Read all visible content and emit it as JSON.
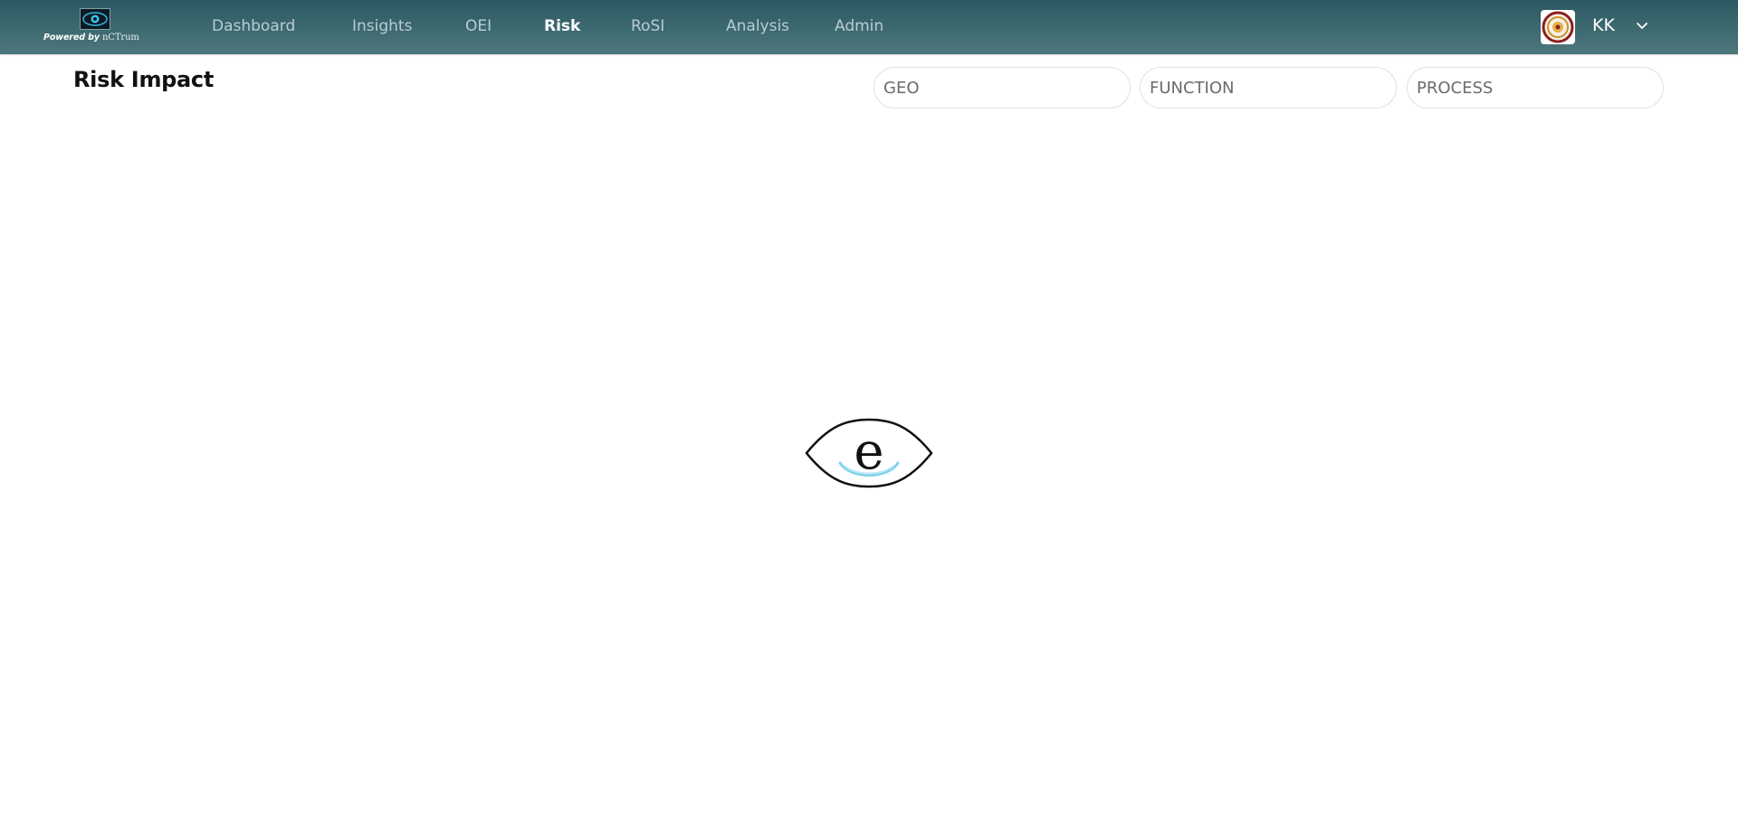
{
  "brand": {
    "powered_by": "Powered by",
    "company": "nCTrum"
  },
  "nav": {
    "items": [
      {
        "label": "Dashboard"
      },
      {
        "label": "Insights"
      },
      {
        "label": "OEI"
      },
      {
        "label": "Risk",
        "active": true
      },
      {
        "label": "RoSI"
      },
      {
        "label": "Analysis"
      },
      {
        "label": "Admin"
      }
    ]
  },
  "user": {
    "initials": "KK"
  },
  "page": {
    "title": "Risk Impact"
  },
  "filters": {
    "geo": {
      "placeholder": "GEO"
    },
    "function": {
      "placeholder": "FUNCTION"
    },
    "process": {
      "placeholder": "PROCESS"
    }
  },
  "loader": {
    "glyph": "e"
  },
  "colors": {
    "topbar": "#3f6b72",
    "nav_text": "#b9cdd1",
    "nav_active": "#ffffff",
    "filter_border": "#d6e8dc",
    "loader_accent": "#7fd3ea"
  },
  "icons": {
    "brand": "eye-logo-icon",
    "avatar": "company-seal-icon",
    "dropdown": "chevron-down-icon",
    "loader": "eye-loader-icon"
  }
}
